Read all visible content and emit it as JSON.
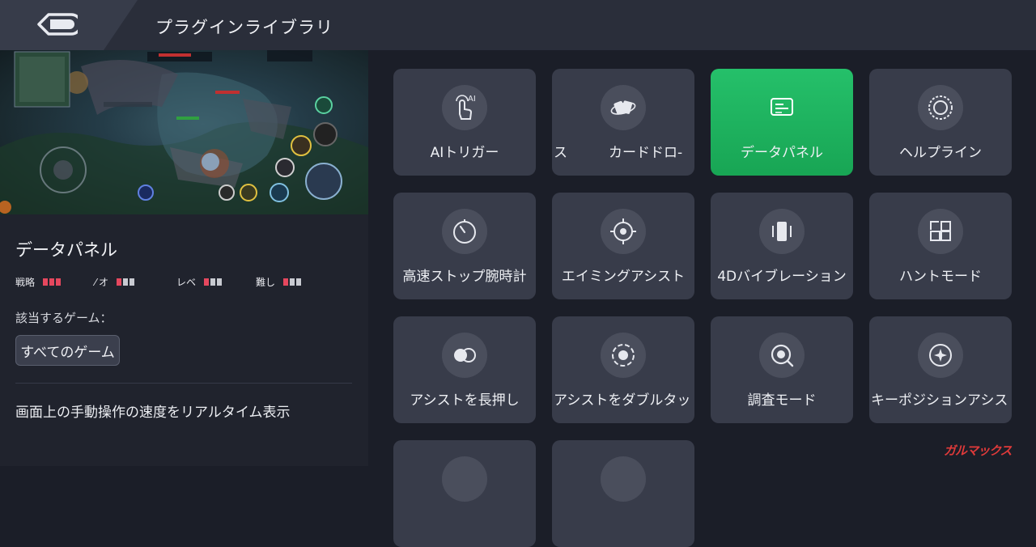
{
  "header": {
    "title": "プラグインライブラリ"
  },
  "plugin_detail": {
    "title": "データパネル",
    "ratings": [
      {
        "label": "戦略",
        "level": 3
      },
      {
        "label": "オ",
        "level": 1
      },
      {
        "label": "レベ",
        "level": 1
      },
      {
        "label": "難し",
        "level": 1
      }
    ],
    "applicable_label": "該当するゲーム：",
    "game_chip": "すべてのゲーム",
    "description": "画面上の手動操作の速度をリアルタイム表示",
    "colors": {
      "rating_on": "#e5475e",
      "rating_off": "#c8cad1"
    }
  },
  "plugins": [
    {
      "label": "AIトリガー",
      "icon": "ai-touch-icon",
      "active": false
    },
    {
      "label": "ス　　　カードドロ-",
      "icon": "card-icon",
      "active": false
    },
    {
      "label": "データパネル",
      "icon": "data-panel-icon",
      "active": true
    },
    {
      "label": "ヘルプライン",
      "icon": "helpline-icon",
      "active": false
    },
    {
      "label": "高速ストップ腕時計",
      "icon": "stopwatch-icon",
      "active": false
    },
    {
      "label": "エイミングアシスト",
      "icon": "crosshair-icon",
      "active": false
    },
    {
      "label": "4Dバイブレーション",
      "icon": "vibration-icon",
      "active": false
    },
    {
      "label": "ハントモード",
      "icon": "hunt-icon",
      "active": false
    },
    {
      "label": "アシストを長押し",
      "icon": "long-press-icon",
      "active": false
    },
    {
      "label": "アシストをダブルタッ",
      "icon": "double-tap-icon",
      "active": false
    },
    {
      "label": "調査モード",
      "icon": "search-mode-icon",
      "active": false
    },
    {
      "label": "キーポジションアシス",
      "icon": "key-position-icon",
      "active": false
    }
  ],
  "accent_color": "#1eb05e",
  "watermark": "ガルマックス"
}
